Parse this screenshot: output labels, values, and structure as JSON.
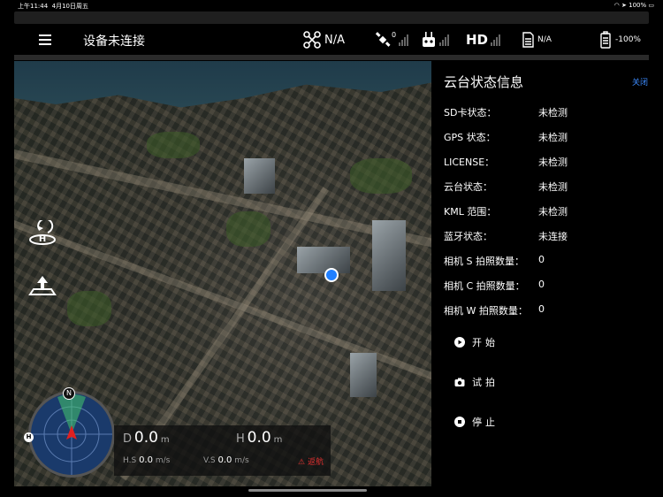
{
  "status_bar": {
    "time": "上午11:44",
    "date": "4月10日周五",
    "battery_text": "100%"
  },
  "toolbar": {
    "title": "设备未连接",
    "drone_mode": "N/A",
    "gps_count": "0",
    "hd_label": "HD",
    "camera_label": "N/A",
    "battery": "-100%"
  },
  "map": {
    "compass_n": "N",
    "compass_h": "H"
  },
  "telemetry": {
    "d_label": "D",
    "d_value": "0.0",
    "d_unit": "m",
    "h_label": "H",
    "h_value": "0.0",
    "h_unit": "m",
    "hs_label": "H.S",
    "hs_value": "0.0",
    "hs_unit": "m/s",
    "vs_label": "V.S",
    "vs_value": "0.0",
    "vs_unit": "m/s",
    "warn_label": "返航"
  },
  "panel": {
    "title": "云台状态信息",
    "close": "关闭",
    "rows": [
      {
        "label": "SD卡状态：",
        "value": "未检测"
      },
      {
        "label": "GPS 状态：",
        "value": "未检测"
      },
      {
        "label": "LICENSE：",
        "value": "未检测"
      },
      {
        "label": "云台状态：",
        "value": "未检测"
      },
      {
        "label": "KML 范围：",
        "value": "未检测"
      },
      {
        "label": "蓝牙状态：",
        "value": "未连接"
      },
      {
        "label": "相机 S 拍照数量：",
        "value": "0"
      },
      {
        "label": "相机 C 拍照数量：",
        "value": "0"
      },
      {
        "label": "相机 W 拍照数量：",
        "value": "0"
      }
    ],
    "actions": [
      {
        "label": "开始",
        "icon": "play-icon"
      },
      {
        "label": "试拍",
        "icon": "camera-icon"
      },
      {
        "label": "停止",
        "icon": "stop-icon"
      }
    ]
  },
  "colors": {
    "accent": "#3d8cff",
    "location_dot": "#1f7fff",
    "radar_fill": "#1a3a6b"
  }
}
